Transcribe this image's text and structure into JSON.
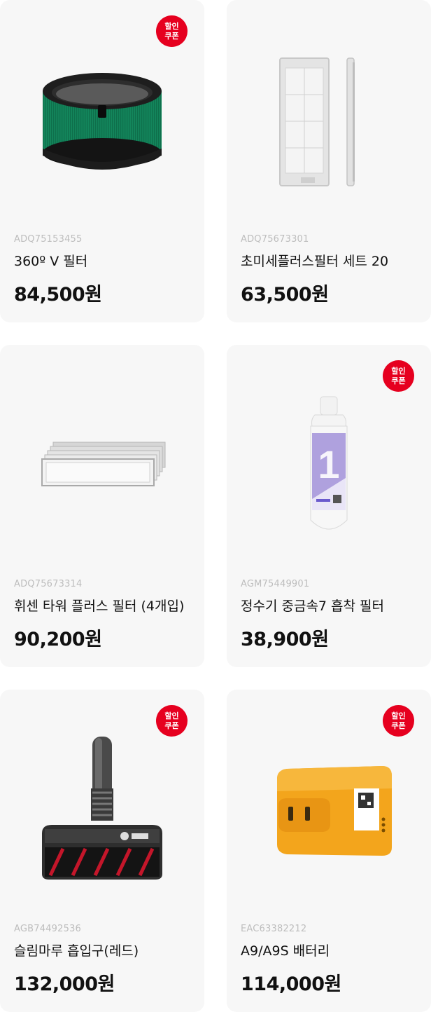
{
  "badge": {
    "line1": "할인",
    "line2": "쿠폰"
  },
  "products": [
    {
      "sku": "ADQ75153455",
      "name": "360º V 필터",
      "price": "84,500원",
      "coupon": true,
      "image": "cylindrical-filter-image"
    },
    {
      "sku": "ADQ75673301",
      "name": "초미세플러스필터 세트 20",
      "price": "63,500원",
      "coupon": false,
      "image": "panel-filter-set-image"
    },
    {
      "sku": "ADQ75673314",
      "name": "휘센 타워 플러스 필터 (4개입)",
      "price": "90,200원",
      "coupon": false,
      "image": "stacked-filter-image"
    },
    {
      "sku": "AGM75449901",
      "name": "정수기 중금속7 흡착 필터",
      "price": "38,900원",
      "coupon": true,
      "image": "water-filter-cartridge-image"
    },
    {
      "sku": "AGB74492536",
      "name": "슬림마루 흡입구(레드)",
      "price": "132,000원",
      "coupon": true,
      "image": "vacuum-nozzle-image"
    },
    {
      "sku": "EAC63382212",
      "name": "A9/A9S 배터리",
      "price": "114,000원",
      "coupon": true,
      "image": "battery-pack-image"
    }
  ]
}
